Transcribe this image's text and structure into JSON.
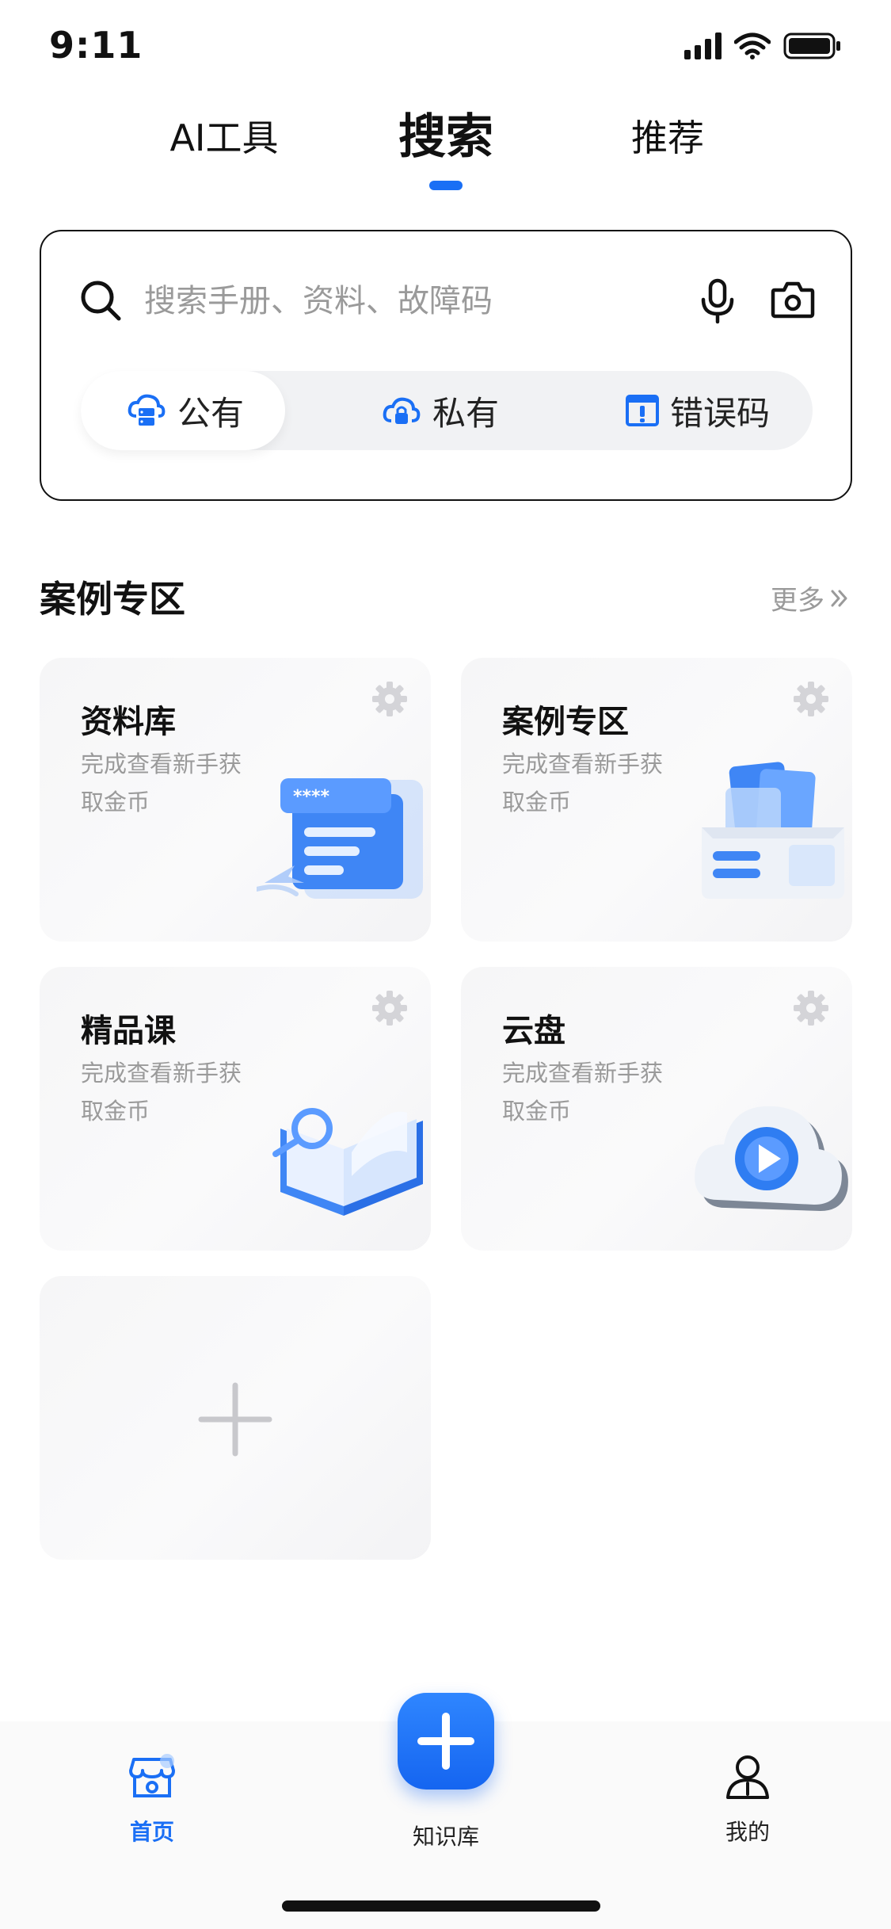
{
  "status_bar": {
    "time": "9:11"
  },
  "top_tabs": [
    {
      "label": "AI工具"
    },
    {
      "label": "搜索"
    },
    {
      "label": "推荐"
    }
  ],
  "search": {
    "placeholder": "搜索手册、资料、故障码",
    "scopes": [
      {
        "label": "公有",
        "icon": "cloud-server-icon"
      },
      {
        "label": "私有",
        "icon": "cloud-lock-icon"
      },
      {
        "label": "错误码",
        "icon": "error-code-icon"
      }
    ]
  },
  "section": {
    "title": "案例专区",
    "more": "更多"
  },
  "cards": [
    {
      "title": "资料库",
      "desc": "完成查看新手获取金币",
      "password_mask": "****"
    },
    {
      "title": "案例专区",
      "desc": "完成查看新手获取金币"
    },
    {
      "title": "精品课",
      "desc": "完成查看新手获取金币"
    },
    {
      "title": "云盘",
      "desc": "完成查看新手获取金币"
    }
  ],
  "bottom_nav": [
    {
      "label": "首页",
      "icon": "shop-icon"
    },
    {
      "label": "知识库",
      "icon": "plus-icon"
    },
    {
      "label": "我的",
      "icon": "user-icon"
    }
  ],
  "colors": {
    "accent": "#1a6ff5",
    "muted": "#9a9a9a",
    "text": "#111111"
  }
}
